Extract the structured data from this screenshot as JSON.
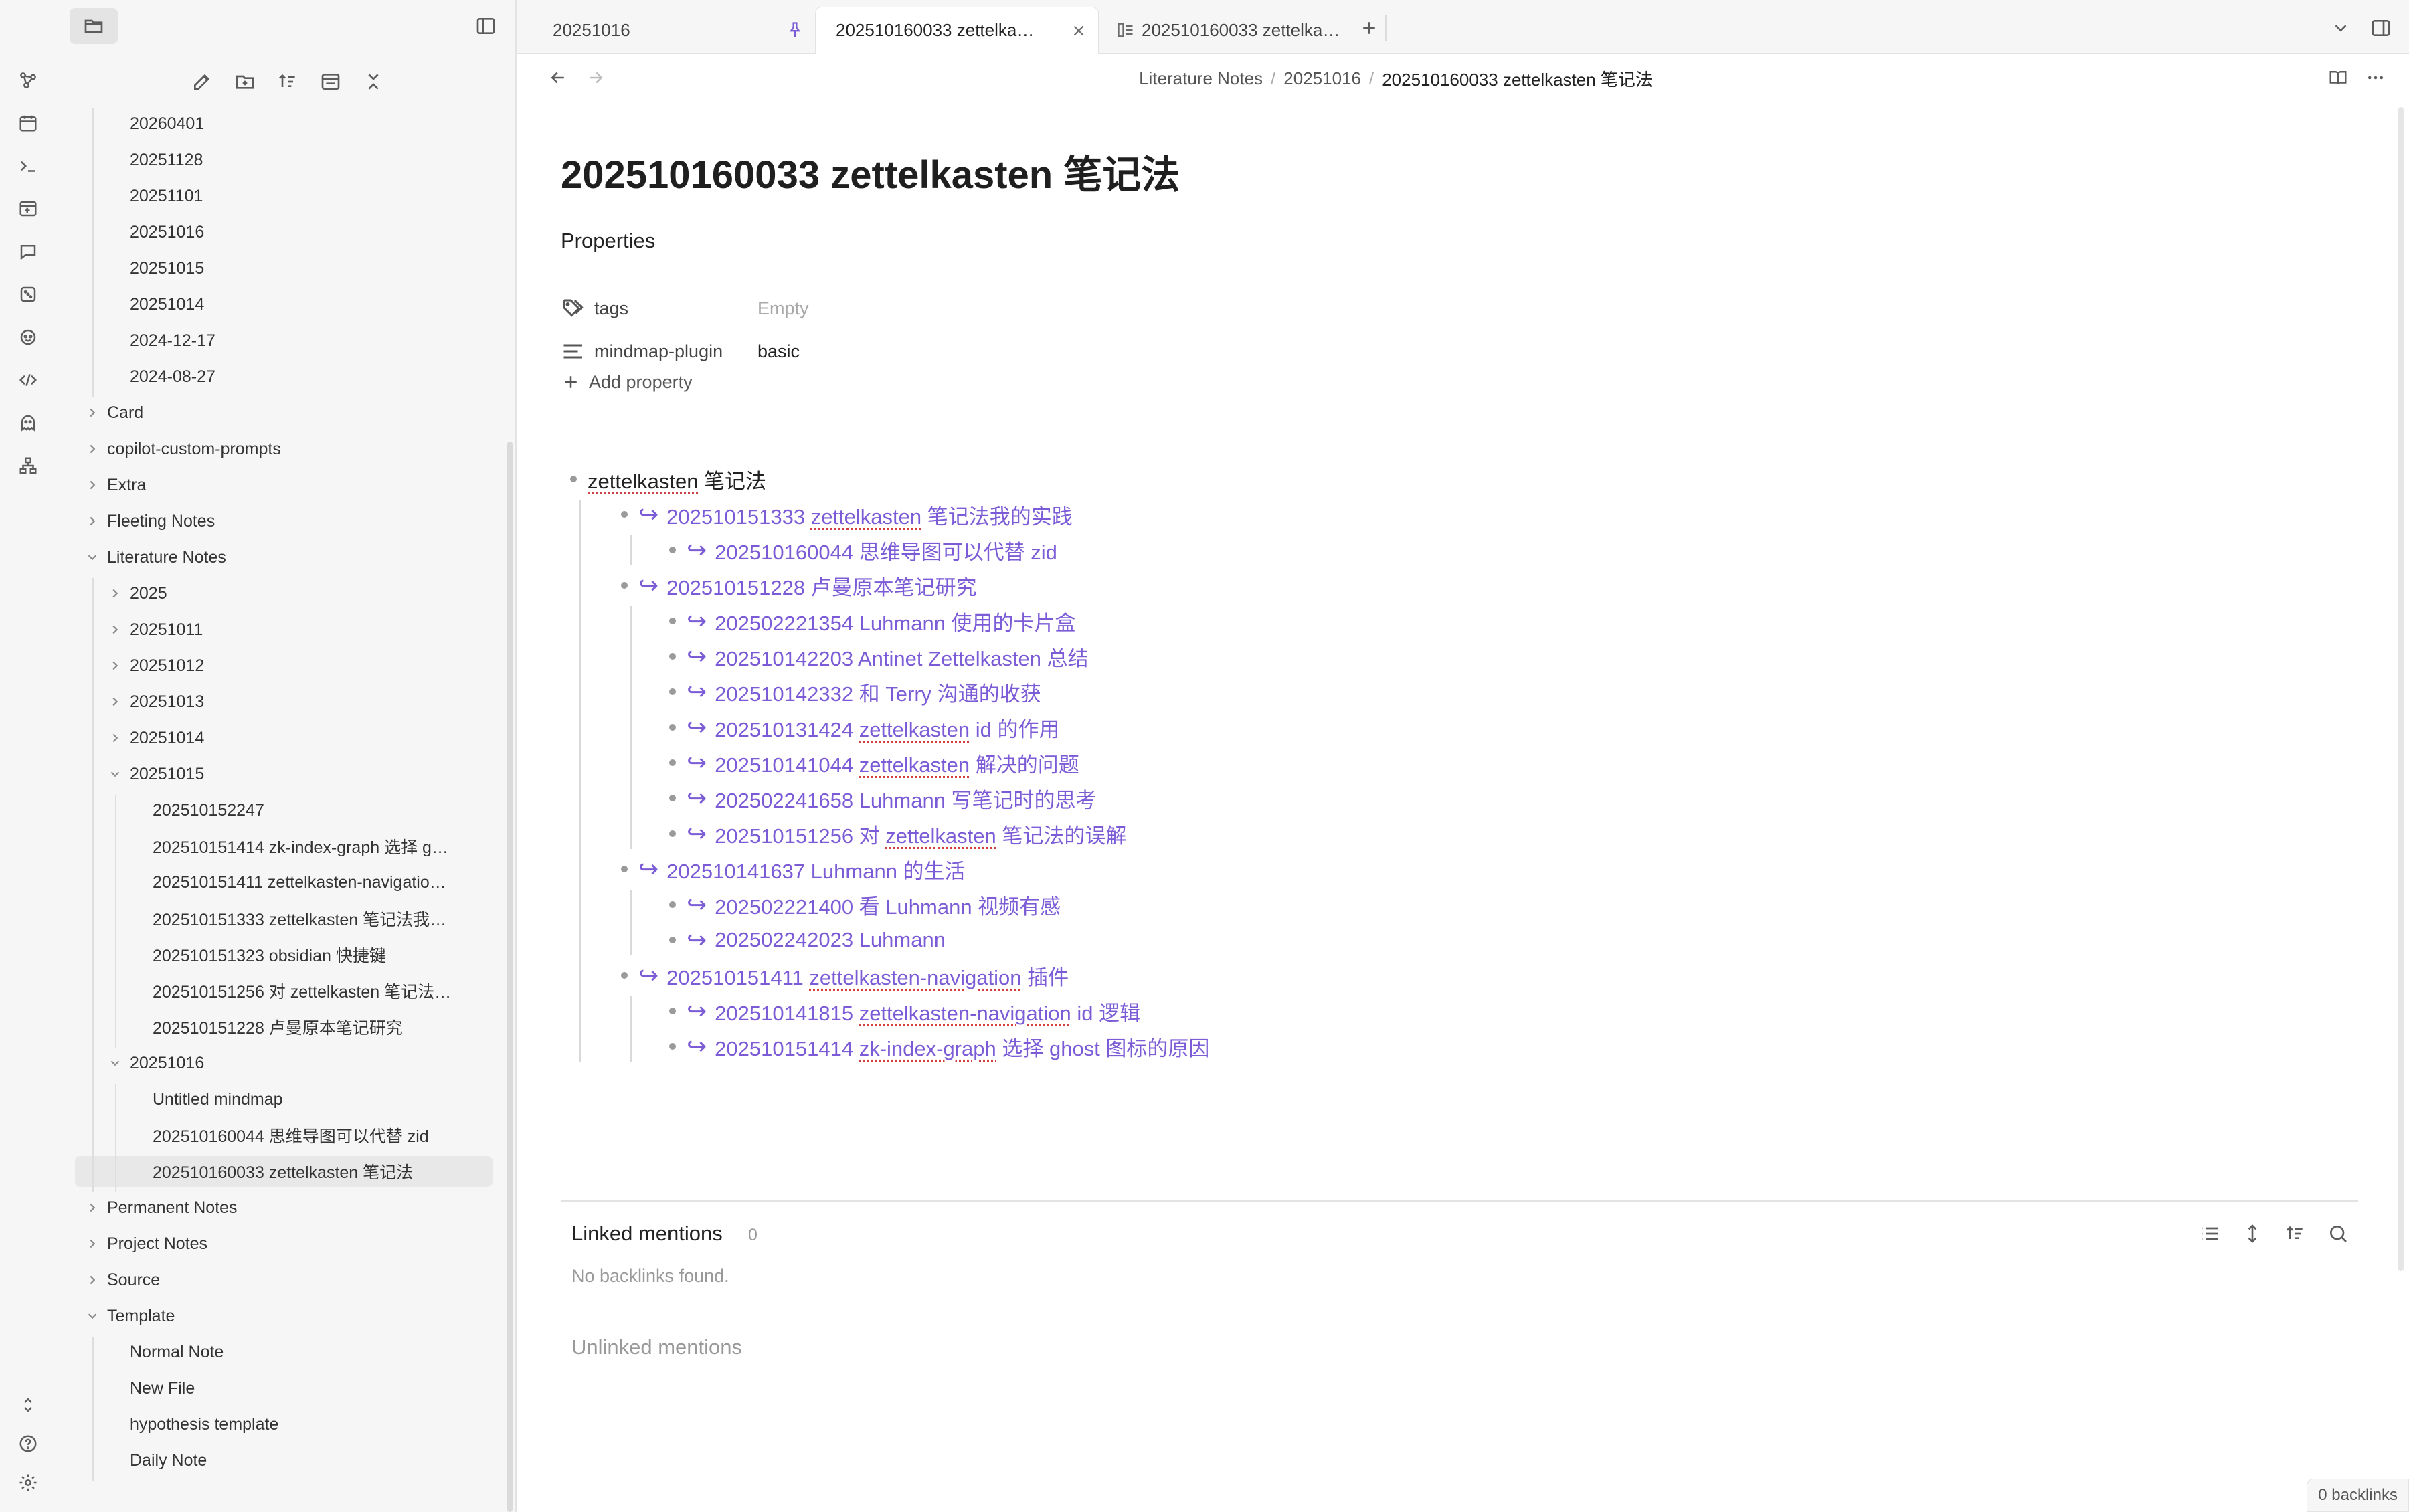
{
  "sidebar": {
    "tree": [
      {
        "label": "20260401",
        "level": 2,
        "type": "file"
      },
      {
        "label": "20251128",
        "level": 2,
        "type": "file"
      },
      {
        "label": "20251101",
        "level": 2,
        "type": "file"
      },
      {
        "label": "20251016",
        "level": 2,
        "type": "file"
      },
      {
        "label": "20251015",
        "level": 2,
        "type": "file"
      },
      {
        "label": "20251014",
        "level": 2,
        "type": "file"
      },
      {
        "label": "2024-12-17",
        "level": 2,
        "type": "file"
      },
      {
        "label": "2024-08-27",
        "level": 2,
        "type": "file"
      },
      {
        "label": "Card",
        "level": 1,
        "type": "folder",
        "open": false
      },
      {
        "label": "copilot-custom-prompts",
        "level": 1,
        "type": "folder",
        "open": false
      },
      {
        "label": "Extra",
        "level": 1,
        "type": "folder",
        "open": false
      },
      {
        "label": "Fleeting Notes",
        "level": 1,
        "type": "folder",
        "open": false
      },
      {
        "label": "Literature Notes",
        "level": 1,
        "type": "folder",
        "open": true
      },
      {
        "label": "2025",
        "level": 2,
        "type": "folder",
        "open": false
      },
      {
        "label": "20251011",
        "level": 2,
        "type": "folder",
        "open": false
      },
      {
        "label": "20251012",
        "level": 2,
        "type": "folder",
        "open": false
      },
      {
        "label": "20251013",
        "level": 2,
        "type": "folder",
        "open": false
      },
      {
        "label": "20251014",
        "level": 2,
        "type": "folder",
        "open": false
      },
      {
        "label": "20251015",
        "level": 2,
        "type": "folder",
        "open": true
      },
      {
        "label": "202510152247",
        "level": 3,
        "type": "file"
      },
      {
        "label": "202510151414 zk-index-graph 选择 g…",
        "level": 3,
        "type": "file"
      },
      {
        "label": "202510151411 zettelkasten-navigatio…",
        "level": 3,
        "type": "file"
      },
      {
        "label": "202510151333 zettelkasten 笔记法我…",
        "level": 3,
        "type": "file"
      },
      {
        "label": "202510151323 obsidian 快捷键",
        "level": 3,
        "type": "file"
      },
      {
        "label": "202510151256 对 zettelkasten 笔记法…",
        "level": 3,
        "type": "file"
      },
      {
        "label": "202510151228 卢曼原本笔记研究",
        "level": 3,
        "type": "file"
      },
      {
        "label": "20251016",
        "level": 2,
        "type": "folder",
        "open": true
      },
      {
        "label": "Untitled mindmap",
        "level": 3,
        "type": "file"
      },
      {
        "label": "202510160044 思维导图可以代替 zid",
        "level": 3,
        "type": "file"
      },
      {
        "label": "202510160033 zettelkasten 笔记法",
        "level": 3,
        "type": "file",
        "active": true
      },
      {
        "label": "Permanent Notes",
        "level": 1,
        "type": "folder",
        "open": false
      },
      {
        "label": "Project Notes",
        "level": 1,
        "type": "folder",
        "open": false
      },
      {
        "label": "Source",
        "level": 1,
        "type": "folder",
        "open": false
      },
      {
        "label": "Template",
        "level": 1,
        "type": "folder",
        "open": true
      },
      {
        "label": "Normal Note",
        "level": 2,
        "type": "file"
      },
      {
        "label": "New File",
        "level": 2,
        "type": "file"
      },
      {
        "label": "hypothesis template",
        "level": 2,
        "type": "file"
      },
      {
        "label": "Daily Note",
        "level": 2,
        "type": "file"
      }
    ]
  },
  "tabs": [
    {
      "label": "20251016",
      "pinned": true,
      "active": false
    },
    {
      "label": "202510160033 zettelka…",
      "active": true
    },
    {
      "label": "202510160033 zettelka…",
      "active": false
    }
  ],
  "breadcrumb": {
    "part1": "Literature Notes",
    "sep": "/",
    "part2": "20251016",
    "part3": "202510160033 zettelkasten 笔记法"
  },
  "note": {
    "title": "202510160033 zettelkasten 笔记法",
    "properties_heading": "Properties",
    "props": [
      {
        "key": "tags",
        "value": "Empty",
        "empty": true,
        "icon": "tags-icon"
      },
      {
        "key": "mindmap-plugin",
        "value": "basic",
        "empty": false,
        "icon": "text-lines-icon"
      }
    ],
    "add_property": "Add property"
  },
  "outline": [
    {
      "level": 0,
      "link": false,
      "parts": [
        [
          "zettelkasten",
          true
        ],
        [
          " 笔记法",
          false
        ]
      ]
    },
    {
      "level": 1,
      "link": true,
      "parts": [
        [
          "202510151333 ",
          false
        ],
        [
          "zettelkasten",
          true
        ],
        [
          " 笔记法我的实践",
          false
        ]
      ]
    },
    {
      "level": 2,
      "link": true,
      "parts": [
        [
          "202510160044 思维导图可以代替 zid",
          false
        ]
      ]
    },
    {
      "level": 1,
      "link": true,
      "parts": [
        [
          "202510151228 卢曼原本笔记研究",
          false
        ]
      ]
    },
    {
      "level": 2,
      "link": true,
      "parts": [
        [
          "202502221354 Luhmann 使用的卡片盒",
          false
        ]
      ]
    },
    {
      "level": 2,
      "link": true,
      "parts": [
        [
          "202510142203 Antinet Zettelkasten 总结",
          false
        ]
      ]
    },
    {
      "level": 2,
      "link": true,
      "parts": [
        [
          "202510142332 和 Terry 沟通的收获",
          false
        ]
      ]
    },
    {
      "level": 2,
      "link": true,
      "parts": [
        [
          "202510131424 ",
          false
        ],
        [
          "zettelkasten",
          true
        ],
        [
          " id 的作用",
          false
        ]
      ]
    },
    {
      "level": 2,
      "link": true,
      "parts": [
        [
          "202510141044 ",
          false
        ],
        [
          "zettelkasten",
          true
        ],
        [
          " 解决的问题",
          false
        ]
      ]
    },
    {
      "level": 2,
      "link": true,
      "parts": [
        [
          "202502241658 Luhmann 写笔记时的思考",
          false
        ]
      ]
    },
    {
      "level": 2,
      "link": true,
      "parts": [
        [
          "202510151256 对 ",
          false
        ],
        [
          "zettelkasten",
          true
        ],
        [
          " 笔记法的误解",
          false
        ]
      ]
    },
    {
      "level": 1,
      "link": true,
      "parts": [
        [
          "202510141637 Luhmann 的生活",
          false
        ]
      ]
    },
    {
      "level": 2,
      "link": true,
      "parts": [
        [
          "202502221400 看 Luhmann 视频有感",
          false
        ]
      ]
    },
    {
      "level": 2,
      "link": true,
      "parts": [
        [
          "202502242023 Luhmann",
          false
        ]
      ]
    },
    {
      "level": 1,
      "link": true,
      "parts": [
        [
          "202510151411 ",
          false
        ],
        [
          "zettelkasten-navigation",
          true
        ],
        [
          " 插件",
          false
        ]
      ]
    },
    {
      "level": 2,
      "link": true,
      "parts": [
        [
          "202510141815 ",
          false
        ],
        [
          "zettelkasten-navigation",
          true
        ],
        [
          " id 逻辑",
          false
        ]
      ]
    },
    {
      "level": 2,
      "link": true,
      "parts": [
        [
          "202510151414 ",
          false
        ],
        [
          "zk-index-graph",
          true
        ],
        [
          " 选择 ghost 图标的原因",
          false
        ]
      ]
    }
  ],
  "backlinks": {
    "linked_title": "Linked mentions",
    "linked_count": "0",
    "linked_empty": "No backlinks found.",
    "unlinked_title": "Unlinked mentions"
  },
  "status_bar": {
    "backlinks": "0 backlinks"
  },
  "colors": {
    "accent": "#7b5cd6",
    "sidebar_bg": "#f6f6f6",
    "spell_underline": "#d04040"
  }
}
